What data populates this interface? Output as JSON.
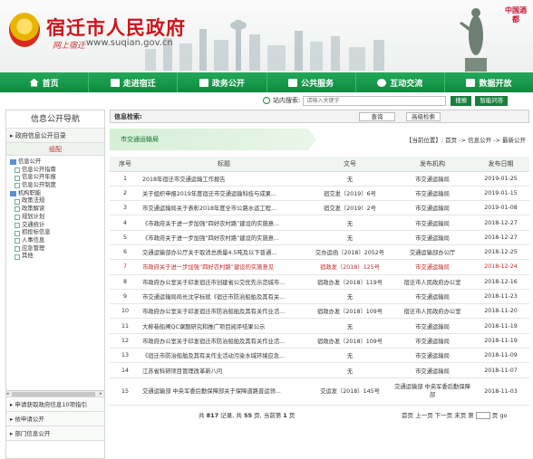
{
  "site": {
    "title": "宿迁市人民政府",
    "url": "www.suqian.gov.cn",
    "url_prefix": "网上宿迁",
    "badge": "中国酒都"
  },
  "nav": [
    {
      "label": "首页",
      "icon": "home-icon"
    },
    {
      "label": "走进宿迁",
      "icon": "image-icon"
    },
    {
      "label": "政务公开",
      "icon": "list-icon"
    },
    {
      "label": "公共服务",
      "icon": "document-icon"
    },
    {
      "label": "互动交流",
      "icon": "chat-icon"
    },
    {
      "label": "数据开放",
      "icon": "chart-icon"
    }
  ],
  "search": {
    "label": "站内搜索:",
    "placeholder": "请输入关键字",
    "button": "搜索",
    "smart": "智能问答"
  },
  "sidebar": {
    "title": "信息公开导航",
    "dir": "▸ 政府信息公开目录",
    "sub": "组配",
    "tree": [
      {
        "label": "信息公开",
        "level": 0,
        "type": "folder"
      },
      {
        "label": "信息公开指南",
        "level": 1,
        "type": "node"
      },
      {
        "label": "信息公开年报",
        "level": 1,
        "type": "node"
      },
      {
        "label": "信息公开制度",
        "level": 1,
        "type": "node"
      },
      {
        "label": "机构职能",
        "level": 0,
        "type": "folder"
      },
      {
        "label": "政策法规",
        "level": 1,
        "type": "node"
      },
      {
        "label": "政策解读",
        "level": 1,
        "type": "node"
      },
      {
        "label": "规划计划",
        "level": 1,
        "type": "node"
      },
      {
        "label": "交通统计",
        "level": 1,
        "type": "node"
      },
      {
        "label": "招投标信息",
        "level": 1,
        "type": "node"
      },
      {
        "label": "人事信息",
        "level": 1,
        "type": "node"
      },
      {
        "label": "应急管理",
        "level": 1,
        "type": "node"
      },
      {
        "label": "其他",
        "level": 1,
        "type": "node"
      }
    ],
    "links": [
      "▸ 申请获取政府信息10项指引",
      "▸ 依申请公开",
      "▸ 部门信息公开"
    ]
  },
  "main": {
    "info_label": "信息检索:",
    "query_btn": "查询",
    "adv_btn": "高级检索",
    "dept": "市交通运输局",
    "crumb": "【当前位置】: 首页 -> 信息公开 -> 最新公开",
    "columns": [
      "序号",
      "标题",
      "文号",
      "发布机构",
      "发布日期"
    ],
    "rows": [
      [
        "1",
        "2018年宿迁市交通运输工作报告",
        "无",
        "市交通运输局",
        "2019-01-25"
      ],
      [
        "2",
        "关于组织申报2019年度宿迁市交通运输科技与成果...",
        "宿交发〔2019〕6号",
        "市交通运输局",
        "2019-01-15"
      ],
      [
        "3",
        "市交通运输局关于表彰2018年度全市公路水运工程...",
        "宿交发〔2019〕2号",
        "市交通运输局",
        "2019-01-08"
      ],
      [
        "4",
        "《市政府关于进一步加强“四好农村路”建设的实施意...",
        "无",
        "市交通运输局",
        "2018-12-27"
      ],
      [
        "5",
        "《市政府关于进一步加强“四好农村路”建设的实施意...",
        "无",
        "市交通运输局",
        "2018-12-27"
      ],
      [
        "6",
        "交通运输部办公厅关于取消总质量4.5吨及以下普通...",
        "交办运函〔2018〕2052号",
        "交通运输部办公厅",
        "2018-12-25"
      ],
      [
        "7",
        "市政府关于进一步加强“四好农村路”建设的实施意见",
        "宿政发〔2018〕125号",
        "市交通运输局",
        "2018-12-24"
      ],
      [
        "8",
        "市政府办公室关于印发宿迁市创建省公交优先示范城市...",
        "宿政办发〔2018〕119号",
        "宿迁市人民政府办公室",
        "2018-12-16"
      ],
      [
        "9",
        "市交通运输局局长沈学标就《宿迁市防治船舶及其有关...",
        "无",
        "市交通运输局",
        "2018-11-23"
      ],
      [
        "10",
        "市政府办公室关于印发宿迁市防治船舶及其有关作业活...",
        "宿政办发〔2018〕109号",
        "宿迁市人民政府办公室",
        "2018-11-20"
      ],
      [
        "11",
        "大柳巷船闸QC课题研究和推广项目阅评结果公示",
        "无",
        "市交通运输局",
        "2018-11-19"
      ],
      [
        "12",
        "市政府办公室关于印发宿迁市防治船舶及其有关作业活...",
        "宿政办发〔2018〕109号",
        "市交通运输局",
        "2018-11-19"
      ],
      [
        "13",
        "《宿迁市防治船舶及其有关作业活动污染水域环境应急...",
        "无",
        "市交通运输局",
        "2018-11-09"
      ],
      [
        "14",
        "江苏省科研项目管理改革新八问",
        "无",
        "市交通运输局",
        "2018-11-07"
      ],
      [
        "15",
        "交通运输部 中央军委后勤保障部关于保障道路普运领...",
        "交运发〔2018〕145号",
        "交通运输部 中央军委后勤保障部",
        "2018-11-03"
      ]
    ],
    "highlight_row": 7,
    "pager": {
      "prefix": "共",
      "total": "817",
      "mid": "记录, 共",
      "pages": "55",
      "mid2": "页, 当前第",
      "current": "1",
      "suffix": "页",
      "links": "首页 上一页 下一页 末页 第",
      "go": "页 go"
    }
  },
  "colors": {
    "brand_red": "#d0121b",
    "nav_green": "#0d8a3f",
    "button_green": "#1a7f3c",
    "highlight": "#c0292b"
  }
}
